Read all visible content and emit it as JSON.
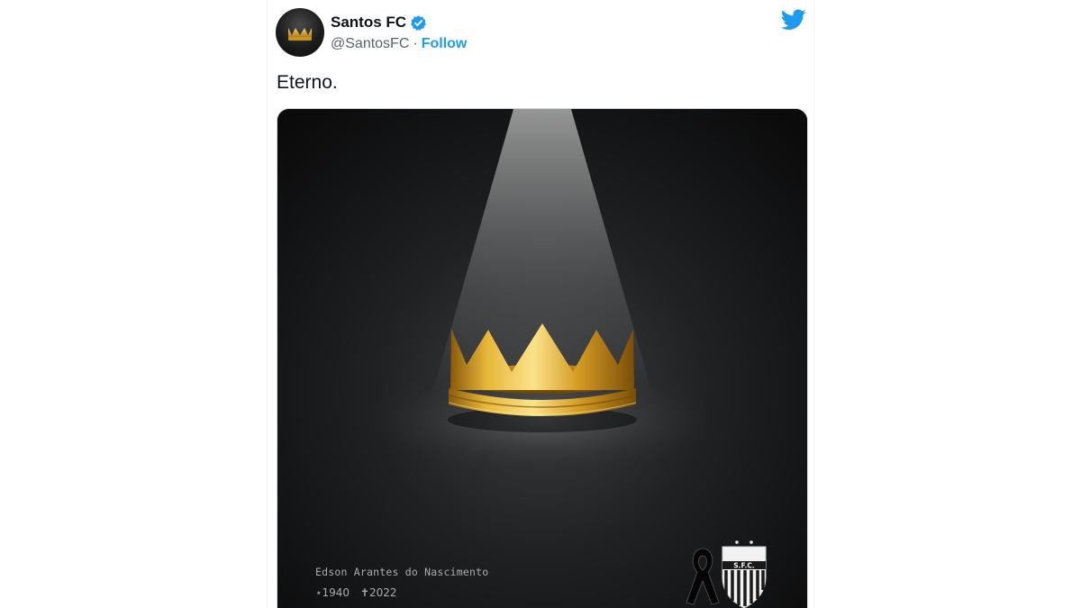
{
  "account": {
    "display_name": "Santos FC",
    "handle": "@SantosFC",
    "separator": "·",
    "follow_label": "Follow"
  },
  "tweet": {
    "text": "Eterno."
  },
  "media": {
    "caption_name": "Edson Arantes do Nascimento",
    "birth": "⋆1940",
    "death": "✝2022",
    "logo_text": "S.F.C."
  },
  "colors": {
    "accent": "#1d9bf0",
    "text": "#0f1419",
    "muted": "#536471",
    "crown_gold": "#d9a520"
  },
  "icons": {
    "verified": "verified-badge-icon",
    "twitter": "twitter-bird-icon",
    "mourning": "mourning-ribbon-icon"
  }
}
